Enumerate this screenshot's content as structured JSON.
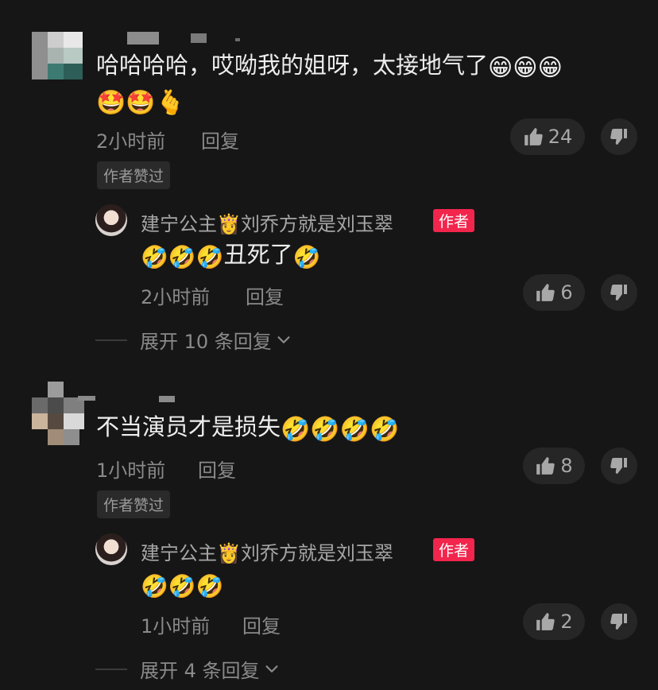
{
  "comments": [
    {
      "text": "哈哈哈哈，哎呦我的姐呀，太接地气了",
      "emoji_line1": "😁😁😁",
      "emoji_line2": "🤩🤩🫰",
      "time": "2小时前",
      "reply_label": "回复",
      "likes": "24",
      "author_liked": "作者赞过",
      "reply": {
        "name": "建宁公主",
        "crown": "👸",
        "name_suffix": "刘乔方就是刘玉翠",
        "author_tag": "作者",
        "text_prefix": "🤣🤣🤣",
        "text": "丑死了",
        "text_suffix": "🤣",
        "time": "2小时前",
        "reply_label": "回复",
        "likes": "6"
      },
      "expand": "展开 10 条回复"
    },
    {
      "text": "不当演员才是损失",
      "emoji_line1": "🤣🤣🤣🤣",
      "time": "1小时前",
      "reply_label": "回复",
      "likes": "8",
      "author_liked": "作者赞过",
      "reply": {
        "name": "建宁公主",
        "crown": "👸",
        "name_suffix": "刘乔方就是刘玉翠",
        "author_tag": "作者",
        "text_prefix": "🤣🤣🤣",
        "time": "1小时前",
        "reply_label": "回复",
        "likes": "2"
      },
      "expand": "展开 4 条回复"
    }
  ],
  "icons": {
    "like": "thumbs-up-icon",
    "dislike": "thumbs-down-icon",
    "chevron": "chevron-down-icon"
  },
  "colors": {
    "background": "#161616",
    "author_tag": "#f2254d",
    "pill": "#262626"
  }
}
